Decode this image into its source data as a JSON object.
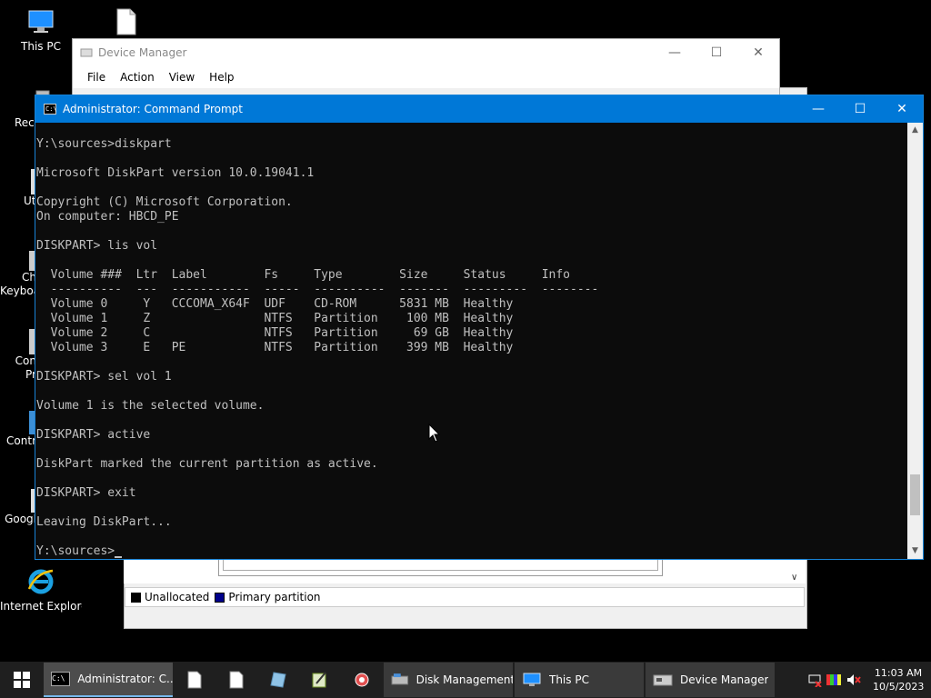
{
  "desktop": {
    "icons": [
      {
        "label": "This PC"
      },
      {
        "label": ""
      },
      {
        "label": "Recy"
      },
      {
        "label": "Ut"
      },
      {
        "label": "Ch\nKeyboa"
      },
      {
        "label": "Con\nPr"
      },
      {
        "label": "Contr"
      },
      {
        "label": "Googl"
      },
      {
        "label": "Internet Explorer"
      }
    ]
  },
  "device_manager": {
    "title": "Device Manager",
    "menu": [
      "File",
      "Action",
      "View",
      "Help"
    ]
  },
  "disk_management": {
    "legend": [
      {
        "label": "Unallocated",
        "color": "#000000"
      },
      {
        "label": "Primary partition",
        "color": "#00008b"
      }
    ]
  },
  "cmd": {
    "title": "Administrator: Command Prompt",
    "lines": [
      "Y:\\sources>diskpart",
      "",
      "Microsoft DiskPart version 10.0.19041.1",
      "",
      "Copyright (C) Microsoft Corporation.",
      "On computer: HBCD_PE",
      "",
      "DISKPART> lis vol",
      "",
      "  Volume ###  Ltr  Label        Fs     Type        Size     Status     Info",
      "  ----------  ---  -----------  -----  ----------  -------  ---------  --------",
      "  Volume 0     Y   CCCOMA_X64F  UDF    CD-ROM      5831 MB  Healthy",
      "  Volume 1     Z                NTFS   Partition    100 MB  Healthy",
      "  Volume 2     C                NTFS   Partition     69 GB  Healthy",
      "  Volume 3     E   PE           NTFS   Partition    399 MB  Healthy",
      "",
      "DISKPART> sel vol 1",
      "",
      "Volume 1 is the selected volume.",
      "",
      "DISKPART> active",
      "",
      "DiskPart marked the current partition as active.",
      "",
      "DISKPART> exit",
      "",
      "Leaving DiskPart...",
      ""
    ],
    "prompt": "Y:\\sources>"
  },
  "taskbar": {
    "apps": [
      {
        "label": "Administrator: C...",
        "icon": "cmd-icon",
        "active": true
      },
      {
        "label": "Disk Management",
        "icon": "disk-management-icon",
        "active": false
      },
      {
        "label": "This PC",
        "icon": "this-pc-icon",
        "active": false
      },
      {
        "label": "Device Manager",
        "icon": "device-manager-icon",
        "active": false
      }
    ],
    "clock": {
      "time": "11:03 AM",
      "date": "10/5/2023"
    }
  }
}
